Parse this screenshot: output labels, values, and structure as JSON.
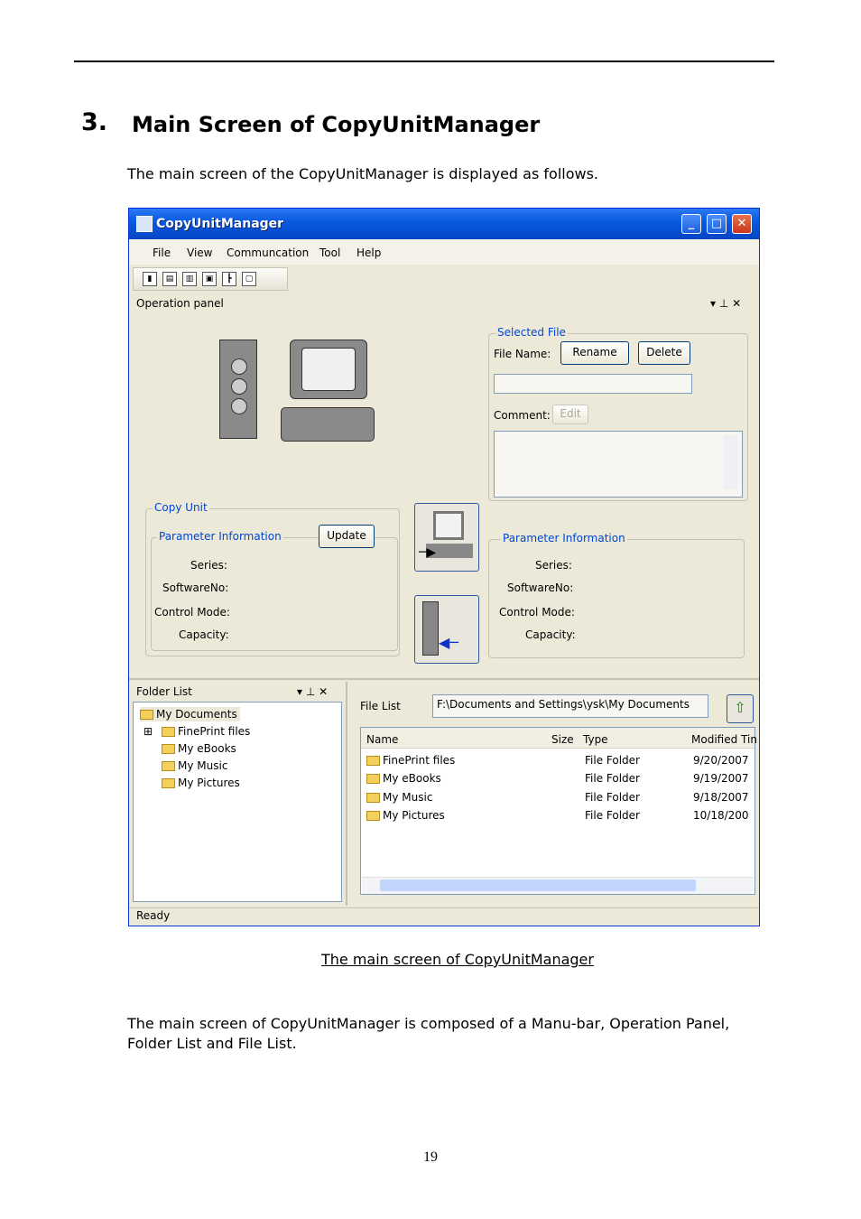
{
  "heading": {
    "number": "3.",
    "title": "Main Screen of CopyUnitManager"
  },
  "intro": "The main screen of the CopyUnitManager is displayed as follows.",
  "window": {
    "title": "CopyUnitManager",
    "menu": [
      "File",
      "View",
      "Communcation",
      "Tool",
      "Help"
    ],
    "operation_panel": {
      "header": "Operation panel",
      "selected_file": {
        "group_title": "Selected File",
        "file_name_label": "File Name:",
        "rename_button": "Rename",
        "delete_button": "Delete",
        "comment_label": "Comment:",
        "edit_button": "Edit"
      },
      "copy_unit": {
        "group_title": "Copy Unit",
        "param_title": "Parameter Information",
        "update_button": "Update",
        "series": "Series:",
        "software_no": "SoftwareNo:",
        "control_mode": "Control Mode:",
        "capacity": "Capacity:"
      },
      "pc_param": {
        "param_title": "Parameter Information",
        "series": "Series:",
        "software_no": "SoftwareNo:",
        "control_mode": "Control Mode:",
        "capacity": "Capacity:"
      }
    },
    "folder_list": {
      "header": "Folder List",
      "root": "My Documents",
      "items": [
        "FinePrint files",
        "My eBooks",
        "My Music",
        "My Pictures"
      ]
    },
    "file_list": {
      "label": "File List",
      "path": "F:\\Documents and Settings\\ysk\\My Documents",
      "columns": [
        "Name",
        "Size",
        "Type",
        "Modified Tin"
      ],
      "rows": [
        {
          "name": "FinePrint files",
          "type": "File Folder",
          "modified": "9/20/2007"
        },
        {
          "name": "My eBooks",
          "type": "File Folder",
          "modified": "9/19/2007"
        },
        {
          "name": "My Music",
          "type": "File Folder",
          "modified": "9/18/2007"
        },
        {
          "name": "My Pictures",
          "type": "File Folder",
          "modified": "10/18/200"
        }
      ]
    },
    "status": "Ready"
  },
  "caption": "The main screen of CopyUnitManager",
  "summary": "The main screen of CopyUnitManager is composed of a Manu-bar, Operation Panel, Folder List and File List.",
  "page_number": "19"
}
